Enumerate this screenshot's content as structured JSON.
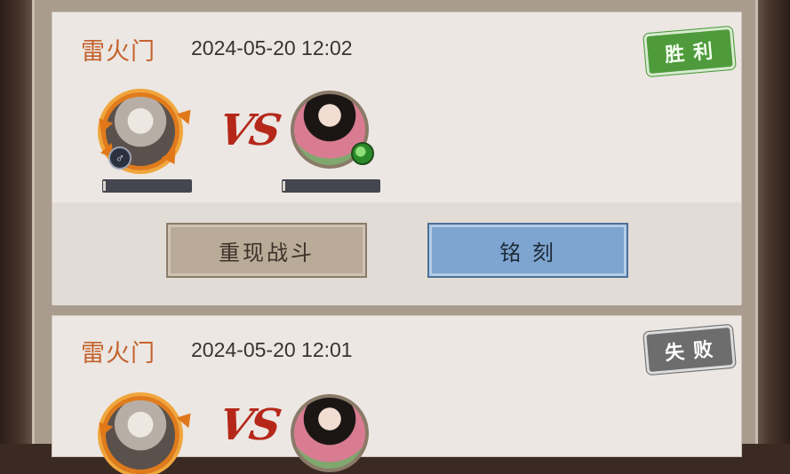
{
  "battles": [
    {
      "sect": "雷火门",
      "time": "2024-05-20 12:02",
      "result": "胜利",
      "result_color": "#4f9b3c",
      "vs_label": "VS",
      "player_gender_icon": "male-symbol-icon",
      "opponent_badge_icon": "jade-gem-icon",
      "buttons": {
        "replay": "重现战斗",
        "engrave": "铭 刻"
      }
    },
    {
      "sect": "雷火门",
      "time": "2024-05-20 12:01",
      "result": "失败",
      "result_color": "#6d6d6d",
      "vs_label": "VS"
    }
  ],
  "colors": {
    "sect_text": "#c4622c",
    "vs": "#b52819",
    "replay_button": "#b9ab98",
    "engrave_button": "#7ea5cf"
  }
}
